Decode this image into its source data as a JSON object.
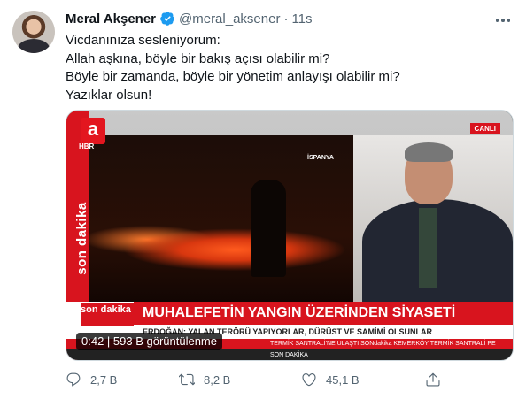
{
  "tweet": {
    "name": "Meral Akşener",
    "handle": "@meral_aksener",
    "separator": "·",
    "time": "11s",
    "lines": [
      "Vicdanınıza sesleniyorum:",
      "Allah aşkına, böyle bir bakış açısı olabilir mi?",
      "Böyle bir zamanda, böyle bir yönetim anlayışı olabilir mi?",
      "Yazıklar olsun!"
    ]
  },
  "video": {
    "channel_logo": "a",
    "channel_sub": "HBR",
    "side_label": "son dakika",
    "live_badge": "CANLI",
    "location_tag": "İSPANYA",
    "corner_tag": "son dakika",
    "headline": "MUHALEFETİN YANGIN ÜZERİNDEN SİYASETİ",
    "subheadline": "ERDOĞAN: YALAN TERÖRÜ YAPIYORLAR, DÜRÜST VE SAMİMİ OLSUNLAR",
    "ticker": "TERMİK SANTRALİ'NE ULAŞTI     SONdakika     KEMERKÖY TERMİK SANTRALİ PE",
    "bottom_strip": "SON DAKİKA",
    "overlay": "0:42 | 593 B görüntülenme"
  },
  "actions": {
    "reply_count": "2,7 B",
    "retweet_count": "8,2 B",
    "like_count": "45,1 B"
  },
  "colors": {
    "verified": "#1d9bf0",
    "muted": "#536471",
    "channel_red": "#d8141e"
  },
  "icons": [
    "verified-badge-icon",
    "more-icon",
    "reply-icon",
    "retweet-icon",
    "like-icon",
    "share-icon"
  ]
}
